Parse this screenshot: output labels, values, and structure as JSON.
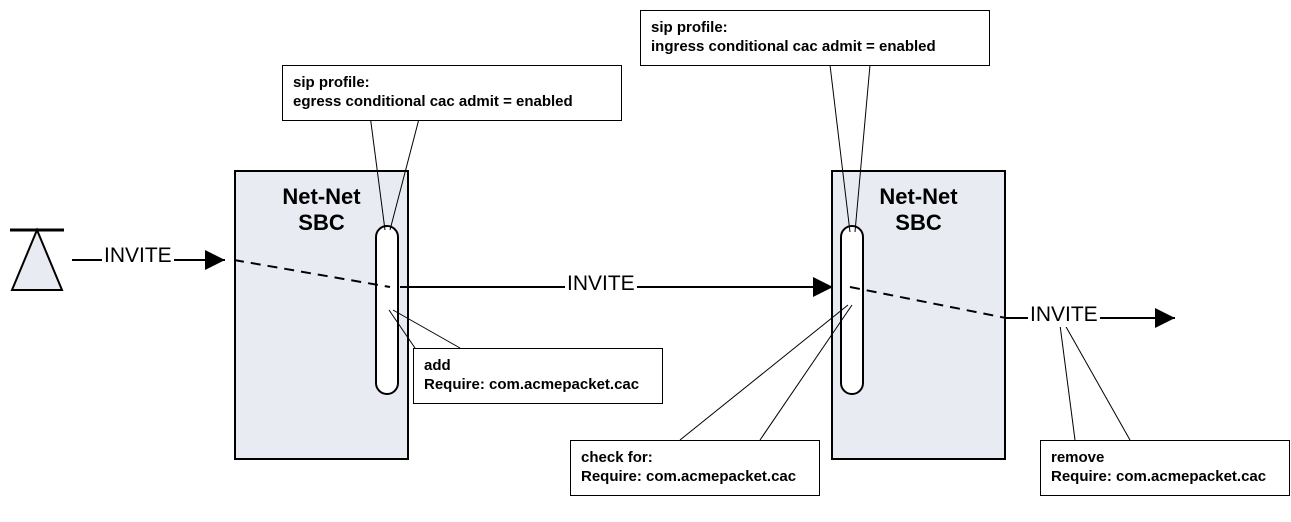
{
  "sbc1": {
    "title_line1": "Net-Net",
    "title_line2": "SBC"
  },
  "sbc2": {
    "title_line1": "Net-Net",
    "title_line2": "SBC"
  },
  "invites": {
    "in": "INVITE",
    "mid": "INVITE",
    "out": "INVITE"
  },
  "callouts": {
    "egress": {
      "line1": "sip profile:",
      "line2": "egress conditional cac admit = enabled"
    },
    "ingress": {
      "line1": "sip profile:",
      "line2": "ingress conditional cac admit = enabled"
    },
    "add": {
      "line1": "add",
      "line2": "Require: com.acmepacket.cac"
    },
    "check": {
      "line1": "check for:",
      "line2": "Require: com.acmepacket.cac"
    },
    "remove": {
      "line1": "remove",
      "line2": "Require: com.acmepacket.cac"
    }
  }
}
